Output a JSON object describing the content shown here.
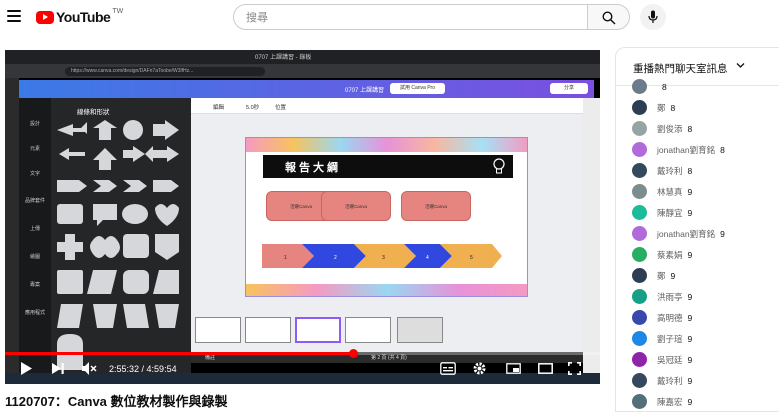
{
  "header": {
    "logo_text": "YouTube",
    "region": "TW",
    "search_placeholder": "搜尋"
  },
  "video": {
    "title": "1120707：Canva 數位教材製作與錄製",
    "time_current": "2:55:32",
    "time_total": "4:59:54",
    "progress": 0.585
  },
  "screen": {
    "window_title": "0707 上課講習 - 錄板",
    "url": "https://www.canva.com/design/DAFn7aToobe/W3lfHz...",
    "canva_title": "0707 上課講習",
    "pro_button": "試用 Canva Pro",
    "share_button": "分享",
    "panel_title": "線條和形狀",
    "slide_title": "報告大綱",
    "card_label": "活躍Canva",
    "arrow_labels": [
      "1",
      "2",
      "3",
      "4",
      "5"
    ],
    "page_indicator": "第 2 頁 (共 4 頁)",
    "notes_label": "備註",
    "duration": "5.0秒",
    "position_label": "位置",
    "sidebar_labels": [
      "設計",
      "元素",
      "文字",
      "品牌套件",
      "上傳",
      "繪圖",
      "專案",
      "應用程式"
    ],
    "edit_label": "編輯"
  },
  "chat": {
    "header": "重播熱門聊天室訊息",
    "messages": [
      {
        "name": "",
        "text": "8",
        "avatar_color": "#6c7a89"
      },
      {
        "name": "鄭",
        "text": "8",
        "avatar_color": "#2c3e50"
      },
      {
        "name": "劉俊添",
        "text": "8",
        "avatar_color": "#95a5a6"
      },
      {
        "name": "jonathan劉育銘",
        "text": "8",
        "avatar_color": "#b06ad9"
      },
      {
        "name": "戴玲利",
        "text": "8",
        "avatar_color": "#34495e"
      },
      {
        "name": "林慧真",
        "text": "9",
        "avatar_color": "#7f8c8d"
      },
      {
        "name": "陳靜宜",
        "text": "9",
        "avatar_color": "#1abc9c"
      },
      {
        "name": "jonathan劉育銘",
        "text": "9",
        "avatar_color": "#b06ad9"
      },
      {
        "name": "蔡素娟",
        "text": "9",
        "avatar_color": "#27ae60"
      },
      {
        "name": "鄭",
        "text": "9",
        "avatar_color": "#2c3e50"
      },
      {
        "name": "洪雨亭",
        "text": "9",
        "avatar_color": "#16a085"
      },
      {
        "name": "高明德",
        "text": "9",
        "avatar_color": "#3949ab"
      },
      {
        "name": "劉子瑄",
        "text": "9",
        "avatar_color": "#1e88e5"
      },
      {
        "name": "吳冠廷",
        "text": "9",
        "avatar_color": "#8e24aa"
      },
      {
        "name": "戴玲利",
        "text": "9",
        "avatar_color": "#34495e"
      },
      {
        "name": "陳嘉宏",
        "text": "9",
        "avatar_color": "#546e7a"
      }
    ]
  },
  "colors": {
    "brand_red": "#ff0000",
    "card_fill": "#e6857f",
    "arrow_colors": [
      "#e6857f",
      "#3047e0",
      "#f0b050",
      "#3047e0",
      "#f0b050"
    ]
  }
}
